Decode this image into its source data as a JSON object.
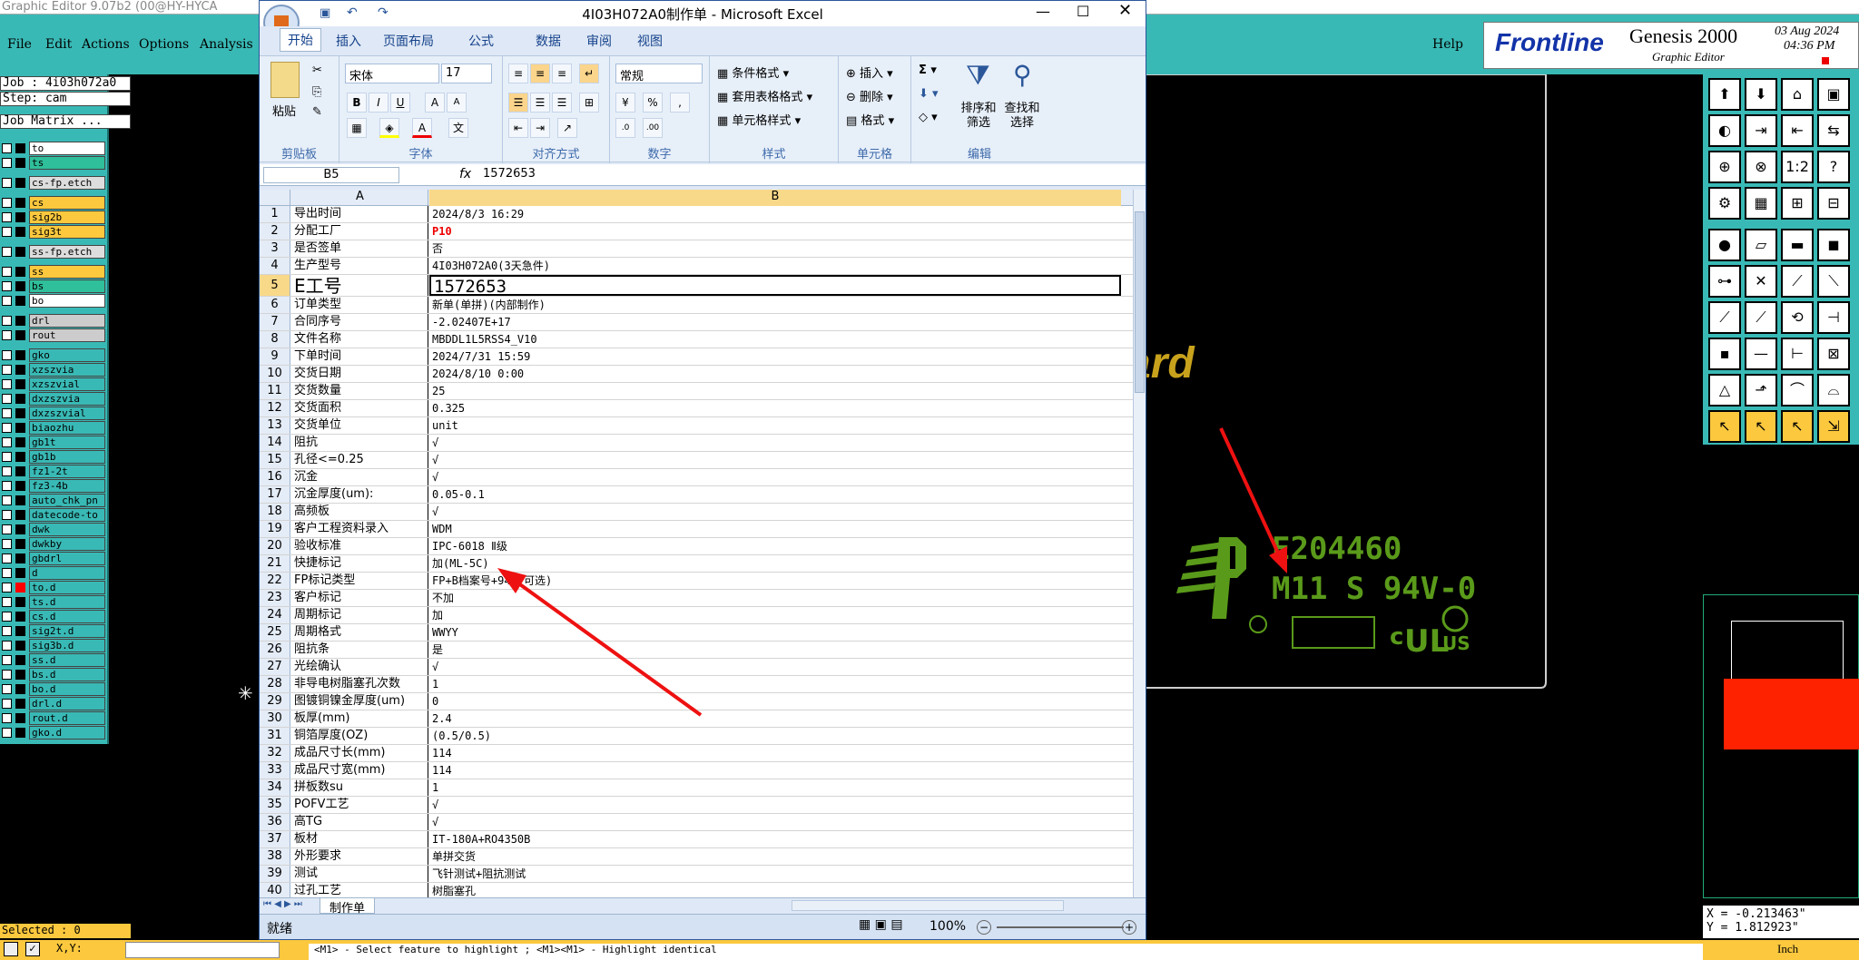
{
  "genesis": {
    "title": "Graphic Editor 9.07b2 (00@HY-HYCA",
    "menu": [
      "File",
      "Edit",
      "Actions",
      "Options",
      "Analysis"
    ],
    "help": "Help",
    "brand": "Frontline",
    "product": "Genesis 2000",
    "subtitle": "Graphic Editor",
    "date": "03 Aug 2024",
    "time": "04:36 PM",
    "job": "Job : 4i03h072a0",
    "step": "Step: cam",
    "job_matrix": "Job Matrix ...",
    "layers": [
      "to",
      "ts",
      "cs-fp.etch",
      "cs",
      "sig2b",
      "sig3t",
      "ss-fp.etch",
      "ss",
      "bs",
      "bo",
      "drl",
      "rout",
      "gko",
      "xzszvia",
      "xzszvial",
      "dxzszvia",
      "dxzszvial",
      "biaozhu",
      "gb1t",
      "gb1b",
      "fz1-2t",
      "fz3-4b",
      "auto_chk_pn",
      "datecode-to",
      "dwk",
      "dwkby",
      "gbdrl",
      "d",
      "to.d",
      "ts.d",
      "cs.d",
      "sig2t.d",
      "sig3b.d",
      "ss.d",
      "bs.d",
      "bo.d",
      "drl.d",
      "rout.d",
      "gko.d"
    ],
    "selected": "Selected : 0",
    "coord_x": "X = -0.213463\"",
    "coord_y": "Y = 1.812923\"",
    "status_msg": "<M1> - Select feature to highlight ; <M1><M1> - Highlight identical",
    "status_xy": "X,Y:",
    "unit": "Inch",
    "board_text": "ard",
    "ul_code": "E204460",
    "ul_rating": "M11 S 94V-0",
    "colors": {
      "teal": "#39b9b5",
      "yellow": "#fbc83e",
      "board": "#5a9a1a"
    }
  },
  "excel": {
    "title": "4I03H072A0制作单 - Microsoft Excel",
    "tabs": [
      "开始",
      "插入",
      "页面布局",
      "公式",
      "数据",
      "审阅",
      "视图"
    ],
    "ribbon": {
      "paste": "粘贴",
      "clipboard": "剪贴板",
      "font_name": "宋体",
      "font_size": "17",
      "font_group": "字体",
      "align_group": "对齐方式",
      "number_format": "常规",
      "number_group": "数字",
      "cond_format": "条件格式",
      "table_format": "套用表格格式",
      "cell_style": "单元格样式",
      "style_group": "样式",
      "insert": "插入",
      "delete": "删除",
      "format": "格式",
      "cells_group": "单元格",
      "sort_filter": "排序和筛选",
      "find_select": "查找和选择",
      "edit_group": "编辑"
    },
    "name_box": "B5",
    "fx": "fx",
    "formula_value": "1572653",
    "col_a": "A",
    "col_b": "B",
    "rows": [
      [
        "1",
        "导出时间",
        "2024/8/3 16:29"
      ],
      [
        "2",
        "分配工厂",
        "P10"
      ],
      [
        "3",
        "是否签单",
        "否"
      ],
      [
        "4",
        "生产型号",
        "4I03H072A0(3天急件)"
      ],
      [
        "5",
        "E工号",
        "1572653"
      ],
      [
        "6",
        "订单类型",
        "新单(单拼)(内部制作)"
      ],
      [
        "7",
        "合同序号",
        "-2.02407E+17"
      ],
      [
        "8",
        "文件名称",
        "MBDDL1L5RSS4_V10"
      ],
      [
        "9",
        "下单时间",
        "2024/7/31 15:59"
      ],
      [
        "10",
        "交货日期",
        "2024/8/10 0:00"
      ],
      [
        "11",
        "交货数量",
        "25"
      ],
      [
        "12",
        "交货面积",
        "0.325"
      ],
      [
        "13",
        "交货单位",
        "unit"
      ],
      [
        "14",
        "阻抗",
        "√"
      ],
      [
        "15",
        "孔径<=0.25",
        "√"
      ],
      [
        "16",
        "沉金",
        "√"
      ],
      [
        "17",
        "沉金厚度(um):",
        "0.05-0.1"
      ],
      [
        "18",
        "高频板",
        "√"
      ],
      [
        "19",
        "客户工程资料录入",
        "WDM"
      ],
      [
        "20",
        "验收标准",
        "IPC-6018 Ⅱ级"
      ],
      [
        "21",
        "快捷标记",
        "加(ML-5C)"
      ],
      [
        "22",
        "FP标记类型",
        "FP+B档案号+94V(可选)"
      ],
      [
        "23",
        "客户标记",
        "不加"
      ],
      [
        "24",
        "周期标记",
        "加"
      ],
      [
        "25",
        "周期格式",
        "WWYY"
      ],
      [
        "26",
        "阻抗条",
        "是"
      ],
      [
        "27",
        "光绘确认",
        "√"
      ],
      [
        "28",
        "非导电树脂塞孔次数",
        "1"
      ],
      [
        "29",
        "图镀铜镍金厚度(um)",
        "0"
      ],
      [
        "30",
        "板厚(mm)",
        "2.4"
      ],
      [
        "31",
        "铜箔厚度(OZ)",
        "(0.5/0.5)"
      ],
      [
        "32",
        "成品尺寸长(mm)",
        "114"
      ],
      [
        "33",
        "成品尺寸宽(mm)",
        "114"
      ],
      [
        "34",
        "拼板数su",
        "1"
      ],
      [
        "35",
        "POFV工艺",
        "√"
      ],
      [
        "36",
        "高TG",
        "√"
      ],
      [
        "37",
        "板材",
        "IT-180A+RO4350B"
      ],
      [
        "38",
        "外形要求",
        "单拼交货"
      ],
      [
        "39",
        "测试",
        "飞针测试+阻抗测试"
      ],
      [
        "40",
        "过孔工艺",
        "树脂塞孔"
      ]
    ],
    "sheet_tab": "制作单",
    "status": "就绪",
    "zoom": "100%"
  }
}
